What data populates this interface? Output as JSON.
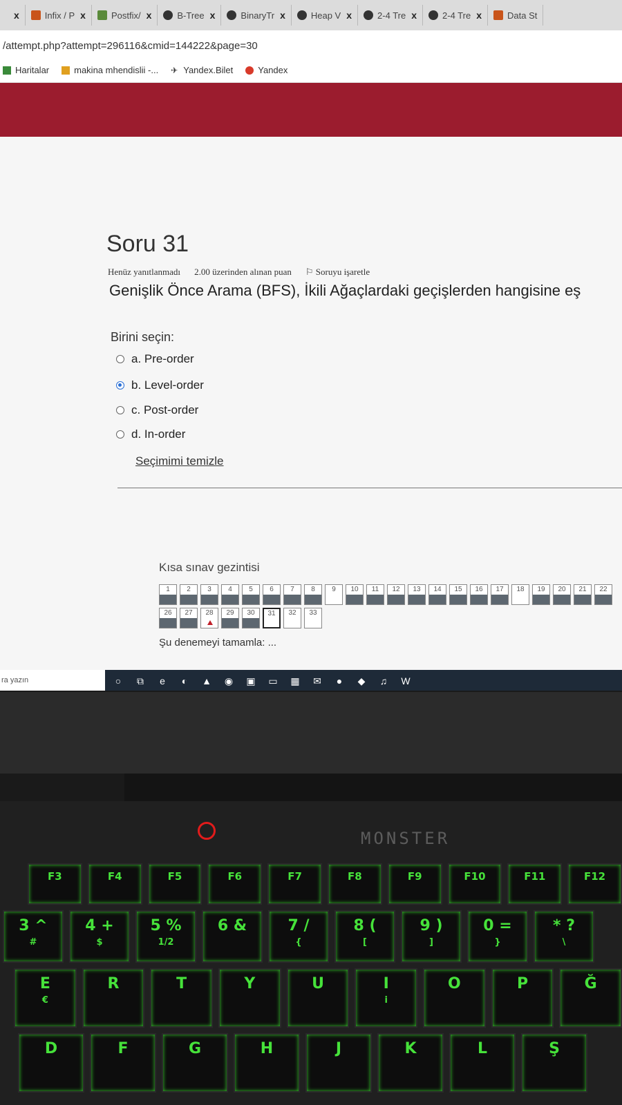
{
  "browser": {
    "tabs": [
      {
        "label": "Infix / P",
        "icon": "mixed-icon"
      },
      {
        "label": "Postfix/",
        "icon": "image-icon"
      },
      {
        "label": "B-Tree",
        "icon": "globe-icon"
      },
      {
        "label": "BinaryTr",
        "icon": "globe-icon"
      },
      {
        "label": "Heap V",
        "icon": "chrome-icon"
      },
      {
        "label": "2-4 Tre",
        "icon": "globe-icon"
      },
      {
        "label": "2-4 Tre",
        "icon": "globe-icon"
      },
      {
        "label": "Data St",
        "icon": "usf-icon"
      }
    ],
    "close_glyph": "x",
    "address": "/attempt.php?attempt=296116&cmid=144222&page=30",
    "bookmarks": [
      {
        "label": "Haritalar",
        "icon": "maps-icon"
      },
      {
        "label": "makina mhendislii -...",
        "icon": "bookmark-icon"
      },
      {
        "label": "Yandex.Bilet",
        "icon": "plane-icon"
      },
      {
        "label": "Yandex",
        "icon": "yandex-icon"
      }
    ],
    "header_color": "#9b1c2e"
  },
  "question": {
    "title": "Soru 31",
    "status": "Henüz yanıtlanmadı",
    "points": "2.00 üzerinden alınan puan",
    "flag_label": "Soruyu işaretle",
    "text": "Genişlik Önce Arama (BFS), İkili Ağaçlardaki geçişlerden hangisine eş",
    "prompt": "Birini seçin:",
    "options": [
      {
        "label": "a. Pre-order",
        "selected": false
      },
      {
        "label": "b. Level-order",
        "selected": true
      },
      {
        "label": "c. Post-order",
        "selected": false
      },
      {
        "label": "d. In-order",
        "selected": false
      }
    ],
    "clear_label": "Seçimimi temizle"
  },
  "navigation": {
    "title": "Kısa sınav gezintisi",
    "row1": [
      "1",
      "2",
      "3",
      "4",
      "5",
      "6",
      "7",
      "8",
      "9",
      "10",
      "11",
      "12",
      "13",
      "14",
      "15",
      "16",
      "17",
      "18",
      "19",
      "20",
      "21",
      "22"
    ],
    "row2": [
      "26",
      "27",
      "28",
      "29",
      "30",
      "31",
      "32",
      "33"
    ],
    "current": "31",
    "flagged": "28",
    "finish_label": "Şu denemeyi tamamla: ..."
  },
  "taskbar": {
    "search_placeholder": "ra yazın",
    "icons": [
      "cortana-icon",
      "task-view-icon",
      "edge-legacy-icon",
      "edge-icon",
      "store-icon",
      "chrome-icon",
      "photos-icon",
      "file-explorer-icon",
      "ms-store-icon",
      "mail-icon",
      "firefox-icon",
      "app-icon",
      "itunes-icon",
      "word-icon"
    ]
  },
  "laptop": {
    "brand": "MONSTER",
    "fkeys": [
      {
        "main": "F3",
        "sub": ""
      },
      {
        "main": "F4",
        "sub": ""
      },
      {
        "main": "F5",
        "sub": ""
      },
      {
        "main": "F6",
        "sub": ""
      },
      {
        "main": "F7",
        "sub": ""
      },
      {
        "main": "F8",
        "sub": ""
      },
      {
        "main": "F9",
        "sub": ""
      },
      {
        "main": "F10",
        "sub": ""
      },
      {
        "main": "F11",
        "sub": ""
      },
      {
        "main": "F12",
        "sub": ""
      }
    ],
    "numkeys": [
      {
        "main": "3 ^",
        "sub": "#"
      },
      {
        "main": "4 +",
        "sub": "$"
      },
      {
        "main": "5 %",
        "sub": "1/2"
      },
      {
        "main": "6 &",
        "sub": ""
      },
      {
        "main": "7 /",
        "sub": "{"
      },
      {
        "main": "8 (",
        "sub": "["
      },
      {
        "main": "9 )",
        "sub": "]"
      },
      {
        "main": "0 =",
        "sub": "}"
      },
      {
        "main": "* ?",
        "sub": "\\"
      }
    ],
    "letters1": [
      {
        "main": "E",
        "sub": "€"
      },
      {
        "main": "R",
        "sub": ""
      },
      {
        "main": "T",
        "sub": ""
      },
      {
        "main": "Y",
        "sub": ""
      },
      {
        "main": "U",
        "sub": ""
      },
      {
        "main": "I",
        "sub": "i"
      },
      {
        "main": "O",
        "sub": ""
      },
      {
        "main": "P",
        "sub": ""
      },
      {
        "main": "Ğ",
        "sub": ""
      }
    ],
    "letters2": [
      {
        "main": "D",
        "sub": ""
      },
      {
        "main": "F",
        "sub": ""
      },
      {
        "main": "G",
        "sub": ""
      },
      {
        "main": "H",
        "sub": ""
      },
      {
        "main": "J",
        "sub": ""
      },
      {
        "main": "K",
        "sub": ""
      },
      {
        "main": "L",
        "sub": ""
      },
      {
        "main": "Ş",
        "sub": ""
      }
    ]
  }
}
